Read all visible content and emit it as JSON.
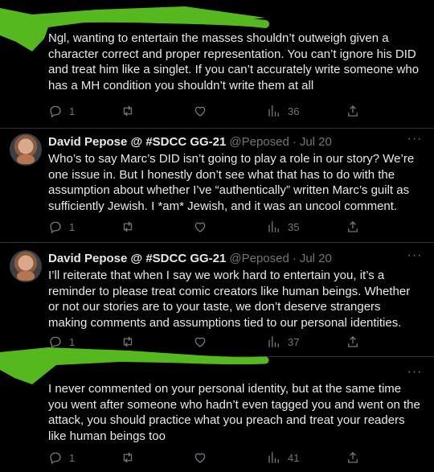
{
  "colors": {
    "background": "#000000",
    "text": "#e7e9ea",
    "muted": "#71767b",
    "divider": "#2f3336",
    "redaction": "#56b81f"
  },
  "tweets": [
    {
      "text": "Ngl, wanting to entertain the masses shouldn’t outweigh given a character correct and proper representation. You can’t ignore his DID and treat him like a singlet. If you can’t accurately write someone who has a MH condition you shouldn’t write them at all",
      "reply_count": "1",
      "retweet_count": "",
      "like_count": "",
      "view_count": "36"
    },
    {
      "name": "David Pepose @ #SDCC GG-21",
      "handle": "@Peposed",
      "sep": "·",
      "date": "Jul 20",
      "text": "Who’s to say Marc’s DID isn’t going to play a role in our story? We’re one issue in. But I honestly don’t see what that has to do with the assumption about whether I’ve “authentically” written Marc’s guilt as sufficiently Jewish. I *am* Jewish, and it was an uncool comment.",
      "reply_count": "1",
      "retweet_count": "",
      "like_count": "",
      "view_count": "35"
    },
    {
      "name": "David Pepose @ #SDCC GG-21",
      "handle": "@Peposed",
      "sep": "·",
      "date": "Jul 20",
      "text": "I’ll reiterate that when I say we work hard to entertain you, it’s a reminder to please treat comic creators like human beings. Whether or not our stories are to your taste, we don’t deserve strangers making comments and assumptions tied to our personal identities.",
      "reply_count": "1",
      "retweet_count": "",
      "like_count": "",
      "view_count": "37"
    },
    {
      "text": "I never commented on your personal identity, but at the same time you went after someone who hadn’t even tagged you and went on the attack, you should practice what you preach and treat your readers like human beings too",
      "reply_count": "1",
      "retweet_count": "",
      "like_count": "",
      "view_count": "41"
    }
  ],
  "icons": {
    "reply": "reply-icon",
    "retweet": "retweet-icon",
    "like": "heart-icon",
    "views": "views-icon",
    "share": "share-icon",
    "more": "more-icon"
  },
  "more_glyph": "···"
}
